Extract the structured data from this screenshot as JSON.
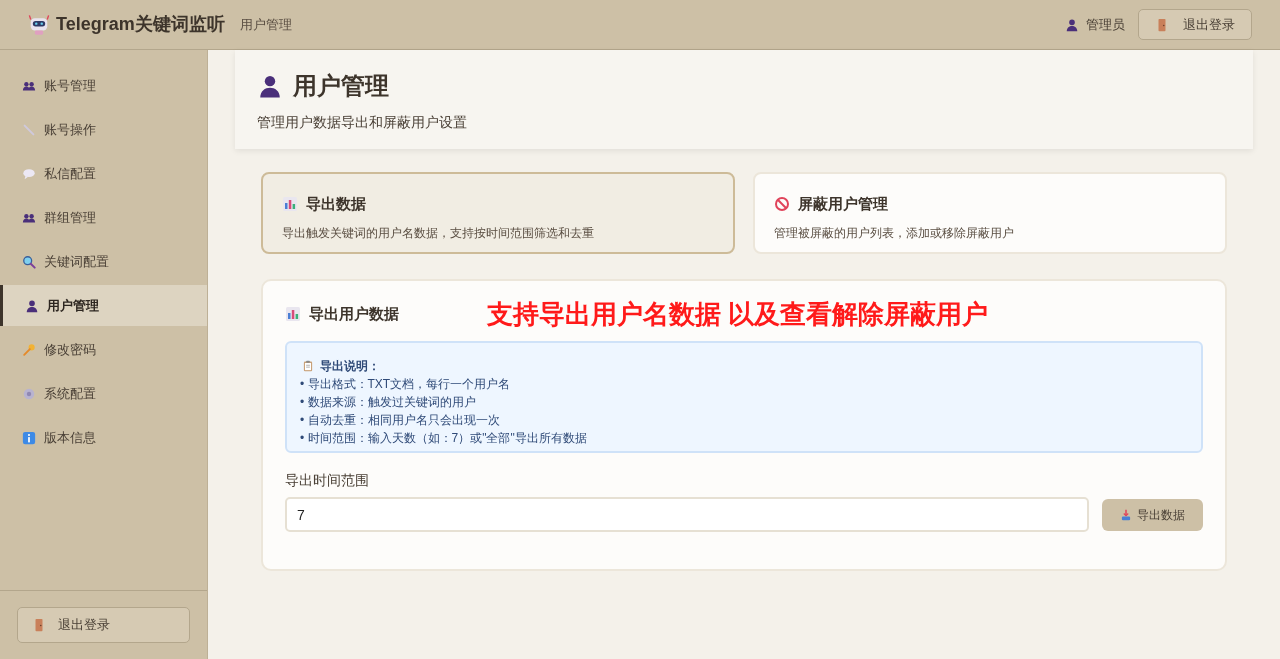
{
  "header": {
    "app_title": "Telegram关键词监听",
    "breadcrumb": "用户管理",
    "user": "管理员",
    "logout_button": "退出登录"
  },
  "sidebar": {
    "items": [
      {
        "label": "账号管理",
        "selected": false
      },
      {
        "label": "账号操作",
        "selected": false
      },
      {
        "label": "私信配置",
        "selected": false
      },
      {
        "label": "群组管理",
        "selected": false
      },
      {
        "label": "关键词配置",
        "selected": false
      },
      {
        "label": "用户管理",
        "selected": true
      },
      {
        "label": "修改密码",
        "selected": false
      },
      {
        "label": "系统配置",
        "selected": false
      },
      {
        "label": "版本信息",
        "selected": false
      }
    ],
    "logout_button": "退出登录"
  },
  "page": {
    "title": "用户管理",
    "subtitle": "管理用户数据导出和屏蔽用户设置"
  },
  "tabs": [
    {
      "title": "导出数据",
      "description": "导出触发关键词的用户名数据，支持按时间范围筛选和去重",
      "selected": true
    },
    {
      "title": "屏蔽用户管理",
      "description": "管理被屏蔽的用户列表，添加或移除屏蔽用户",
      "selected": false
    }
  ],
  "export_panel": {
    "title": "导出用户数据",
    "annotation": "支持导出用户名数据 以及查看解除屏蔽用户",
    "info": {
      "title": "导出说明：",
      "lines": [
        "• 导出格式：TXT文档，每行一个用户名",
        "• 数据来源：触发过关键词的用户",
        "• 自动去重：相同用户名只会出现一次",
        "• 时间范围：输入天数（如：7）或\"全部\"导出所有数据"
      ]
    },
    "range_label": "导出时间范围",
    "range_value": "7",
    "export_button": "导出数据"
  }
}
